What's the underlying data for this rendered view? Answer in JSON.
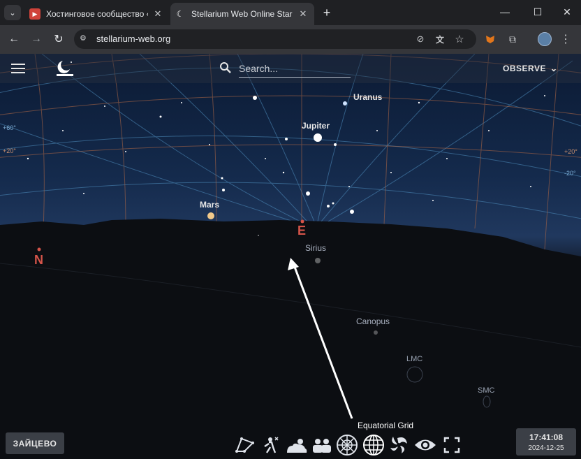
{
  "browser": {
    "tabs": [
      {
        "title": "Хостинговое сообщество «Tim",
        "favicon": "red-play-icon",
        "active": false
      },
      {
        "title": "Stellarium Web Online Star Map",
        "favicon": "moon-icon",
        "active": true
      }
    ],
    "url": "stellarium-web.org"
  },
  "app": {
    "search_placeholder": "Search...",
    "observe_label": "OBSERVE",
    "location_label": "ЗАЙЦЕВО",
    "time": "17:41:08",
    "date": "2024-12-25",
    "tooltip": "Equatorial Grid"
  },
  "sky_labels": {
    "uranus": "Uranus",
    "jupiter": "Jupiter",
    "mars": "Mars",
    "sirius": "Sirius",
    "canopus": "Canopus",
    "lmc": "LMC",
    "smc": "SMC",
    "north": "N",
    "east": "E",
    "grid_left_1": "+60°",
    "grid_left_2": "+20°",
    "grid_right_1": "+20°",
    "grid_right_2": "-20°"
  },
  "bottom_toolbar": [
    "constellations-icon",
    "atmosphere-icon",
    "landscape-icon",
    "azimuthal-grid-icon",
    "equatorial-grid-icon",
    "nebulae-icon",
    "dso-icon",
    "fullscreen-icon"
  ],
  "colors": {
    "accent_red": "#d5544a",
    "grid_blue": "#4f8fbf",
    "grid_orange": "#b56a45"
  }
}
